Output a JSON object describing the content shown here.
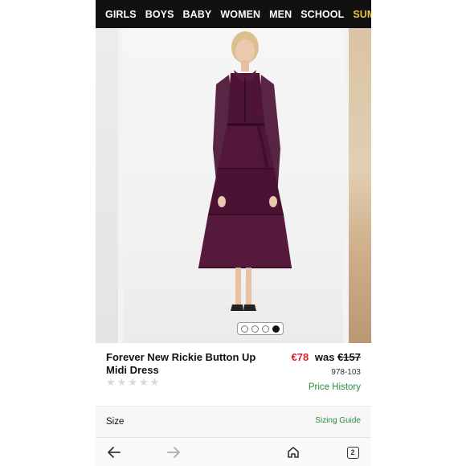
{
  "nav": {
    "items": [
      {
        "label": "GIRLS"
      },
      {
        "label": "BOYS"
      },
      {
        "label": "BABY"
      },
      {
        "label": "WOMEN"
      },
      {
        "label": "MEN"
      },
      {
        "label": "SCHOOL"
      },
      {
        "label": "SUMM"
      }
    ],
    "highlight_color": "#f2c230"
  },
  "gallery": {
    "image_count": 4,
    "active_index": 3
  },
  "product": {
    "title": "Forever New Rickie Button Up Midi Dress",
    "price_now": "€78",
    "price_was_prefix": "was",
    "price_was": "€157",
    "sku": "978-103",
    "price_history_label": "Price History",
    "rating_stars": 5,
    "rating_value": 0,
    "price_color": "#d81f26",
    "link_color": "#2e8b3e"
  },
  "size": {
    "label": "Size",
    "guide_label": "Sizing Guide"
  },
  "browser": {
    "back_icon": "arrow-left-icon",
    "forward_icon": "arrow-right-icon",
    "home_icon": "home-icon",
    "tab_count": "2"
  }
}
